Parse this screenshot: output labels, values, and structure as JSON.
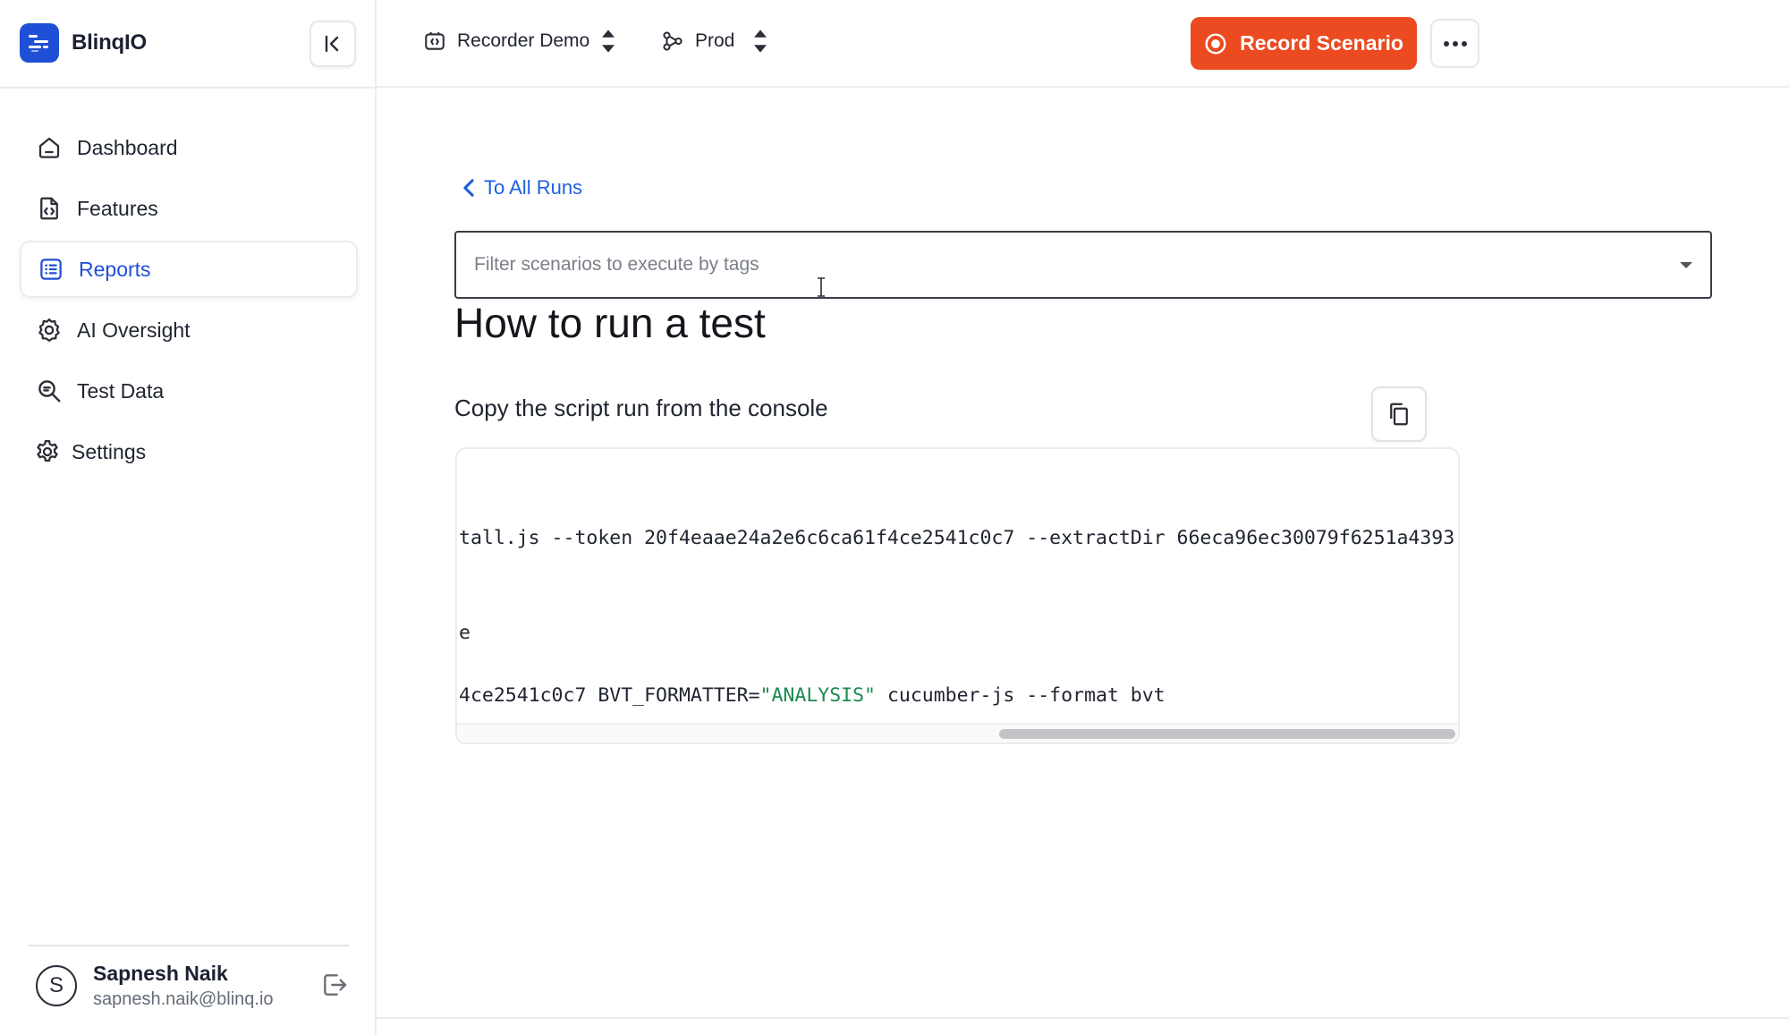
{
  "brand": {
    "name": "BlinqIO"
  },
  "nav": {
    "items": [
      {
        "label": "Dashboard",
        "icon": "home-icon"
      },
      {
        "label": "Features",
        "icon": "code-file-icon"
      },
      {
        "label": "Reports",
        "icon": "list-icon",
        "active": true
      },
      {
        "label": "AI Oversight",
        "icon": "ai-gear-icon"
      },
      {
        "label": "Test Data",
        "icon": "search-doc-icon"
      },
      {
        "label": "Settings",
        "icon": "gear-icon"
      }
    ]
  },
  "user": {
    "name": "Sapnesh Naik",
    "email": "sapnesh.naik@blinq.io",
    "initial": "S"
  },
  "topbar": {
    "project": "Recorder Demo",
    "environment": "Prod",
    "record_label": "Record Scenario"
  },
  "main": {
    "back_label": "To All Runs",
    "filter_placeholder": "Filter scenarios to execute by tags",
    "title": "How to run a test",
    "subtitle": "Copy the script run from the console",
    "code": {
      "line1": "tall.js --token 20f4eaae24a2e6c6ca61f4ce2541c0c7 --extractDir 66eca96ec30079f6251a4393",
      "line2": "e",
      "line3_prefix": "4ce2541c0c7 BVT_FORMATTER=",
      "line3_string": "\"ANALYSIS\"",
      "line3_suffix": " cucumber-js --format bvt"
    }
  },
  "colors": {
    "accent": "#1f4fd6",
    "record": "#ec4a21",
    "link": "#1f5fe0",
    "string": "#1a8a4d"
  }
}
